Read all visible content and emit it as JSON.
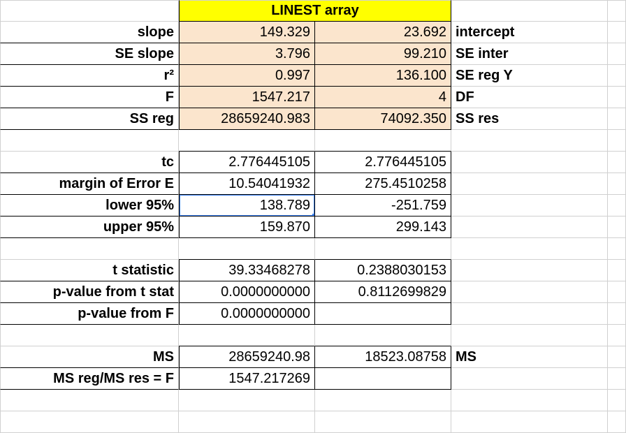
{
  "header": {
    "title": "LINEST array"
  },
  "left_labels": {
    "slope": "slope",
    "se_slope": "SE slope",
    "r2": "r²",
    "F": "F",
    "ss_reg": "SS reg",
    "tc": "tc",
    "margin_error": "margin of Error E",
    "lower95": "lower 95%",
    "upper95": "upper 95%",
    "t_stat": "t statistic",
    "p_from_t": "p-value from t stat",
    "p_from_F": "p-value from F",
    "MS": "MS",
    "msreg_msres": "MS reg/MS res = F"
  },
  "right_labels": {
    "intercept": "intercept",
    "se_inter": "SE inter",
    "se_reg_y": "SE reg Y",
    "DF": "DF",
    "ss_res": "SS res",
    "MS": "MS"
  },
  "linest": {
    "slope": "149.329",
    "intercept": "23.692",
    "se_slope": "3.796",
    "se_inter": "99.210",
    "r2": "0.997",
    "se_reg_y": "136.100",
    "F": "1547.217",
    "DF": "4",
    "ss_reg": "28659240.983",
    "ss_res": "74092.350"
  },
  "calc": {
    "tc_a": "2.776445105",
    "tc_b": "2.776445105",
    "E_a": "10.54041932",
    "E_b": "275.4510258",
    "lower_a": "138.789",
    "lower_b": "-251.759",
    "upper_a": "159.870",
    "upper_b": "299.143",
    "tstat_a": "39.33468278",
    "tstat_b": "0.2388030153",
    "pt_a": "0.0000000000",
    "pt_b": "0.8112699829",
    "pF": "0.0000000000",
    "MS_a": "28659240.98",
    "MS_b": "18523.08758",
    "msreg_msres": "1547.217269"
  }
}
